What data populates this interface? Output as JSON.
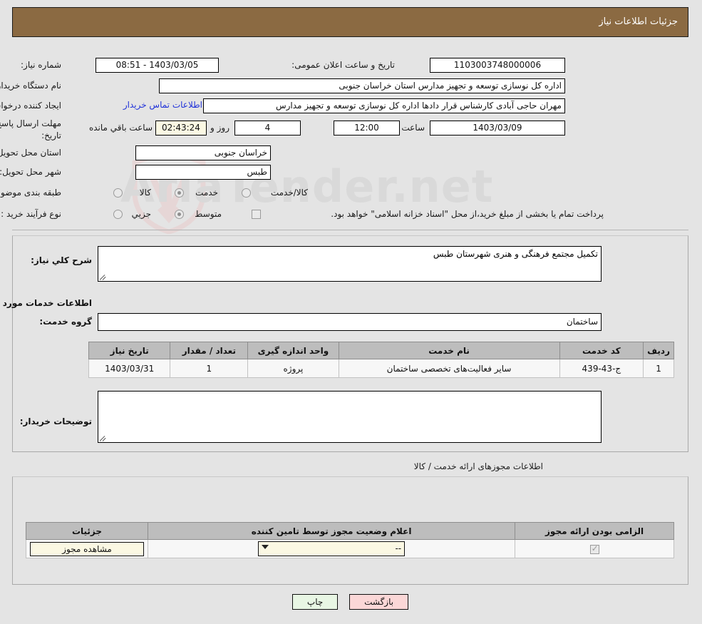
{
  "header": {
    "title": "جزئیات اطلاعات نیاز"
  },
  "form": {
    "need_number_label": "شماره نیاز:",
    "need_number_value": "1103003748000006",
    "announce_datetime_label": "تاریخ و ساعت اعلان عمومی:",
    "announce_datetime_value": "1403/03/05 - 08:51",
    "buyer_org_label": "نام دستگاه خریدار:",
    "buyer_org_value": "اداره کل نوسازی  توسعه و تجهیز مدارس استان خراسان جنوبی",
    "requester_label": "ایجاد کننده درخواست:",
    "requester_value": "مهران حاجی آبادی کارشناس قرار دادها اداره کل نوسازی  توسعه و تجهیز مدارس",
    "contact_link": "اطلاعات تماس خریدار",
    "deadline_label": "مهلت ارسال پاسخ: تا تاریخ:",
    "deadline_date": "1403/03/09",
    "deadline_time_label": "ساعت",
    "deadline_time": "12:00",
    "remaining_days": "4",
    "remaining_days_unit": "روز و",
    "remaining_timer": "02:43:24",
    "remaining_suffix": "ساعت باقي مانده",
    "province_label": "استان محل تحویل:",
    "province_value": "خراسان جنوبی",
    "city_label": "شهر محل تحویل:",
    "city_value": "طبس",
    "category_label": "طبقه بندی موضوعی:",
    "category_options": [
      {
        "label": "کالا",
        "selected": false
      },
      {
        "label": "خدمت",
        "selected": true
      },
      {
        "label": "کالا/خدمت",
        "selected": false
      }
    ],
    "process_label": "نوع فرآیند خرید :",
    "process_options": [
      {
        "label": "جزیي",
        "selected": false
      },
      {
        "label": "متوسط",
        "selected": true
      }
    ],
    "treasury_checkbox_checked": false,
    "treasury_note": "پرداخت تمام یا بخشی از مبلغ خرید،از محل \"اسناد خزانه اسلامی\" خواهد بود."
  },
  "description": {
    "general_label": "شرح کلي نیاز:",
    "general_value": "تکمیل مجتمع فرهنگی و هنری شهرستان طبس",
    "services_section_title": "اطلاعات خدمات مورد نیاز",
    "service_group_label": "گروه خدمت:",
    "service_group_value": "ساختمان",
    "buyer_notes_label": "توضیحات خریدار:",
    "buyer_notes_value": ""
  },
  "service_table": {
    "columns": [
      "ردیف",
      "کد خدمت",
      "نام خدمت",
      "واحد اندازه گیری",
      "تعداد / مقدار",
      "تاریخ نیاز"
    ],
    "rows": [
      {
        "row": "1",
        "code": "ج-43-439",
        "name": "سایر فعالیت‌های تخصصی ساختمان",
        "unit": "پروژه",
        "quantity": "1",
        "need_date": "1403/03/31"
      }
    ]
  },
  "license_section": {
    "outside_title": "اطلاعات مجوزهای ارائه خدمت / کالا",
    "columns": [
      "الزامی بودن ارائه مجوز",
      "اعلام وضعیت مجوز توسط تامین کننده",
      "جزئیات"
    ],
    "rows": [
      {
        "required_checked": true,
        "status_value": "--",
        "detail_button": "مشاهده مجوز"
      }
    ]
  },
  "footer": {
    "print_label": "چاپ",
    "back_label": "بازگشت"
  },
  "watermark": {
    "text": "AriaTender.net"
  },
  "colors": {
    "header_bg": "#8b6a42",
    "page_bg": "#e4e4e4",
    "link": "#2133d9",
    "print_btn": "#e8f6e4",
    "back_btn": "#fbd7d7",
    "cream_field": "#fbf8e3"
  }
}
